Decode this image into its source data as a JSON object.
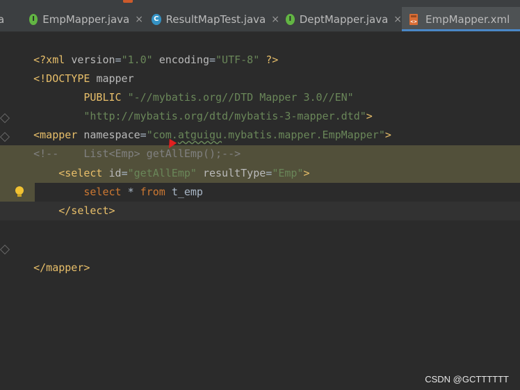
{
  "tabs": [
    {
      "label": "EmpMapper.java",
      "icon": "interface-icon",
      "active": false
    },
    {
      "label": "ResultMapTest.java",
      "icon": "class-icon",
      "active": false
    },
    {
      "label": "DeptMapper.java",
      "icon": "interface-icon",
      "active": false
    },
    {
      "label": "EmpMapper.xml",
      "icon": "xml-file-icon",
      "active": true
    }
  ],
  "tab_close": "×",
  "tab_prefix": "a",
  "colors": {
    "tag": "#e8bf6a",
    "string": "#6a8759",
    "keyword": "#cc7832",
    "comment": "#808080",
    "highlight": "#52503a",
    "active_tab_underline": "#4a88c7"
  },
  "code": {
    "l1": {
      "a": "<?xml ",
      "b": "version",
      "c": "=",
      "d": "\"1.0\"",
      "e": " encoding",
      "f": "=",
      "g": "\"UTF-8\"",
      "h": " ?>"
    },
    "l2": {
      "a": "<!DOCTYPE ",
      "b": "mapper"
    },
    "l3": {
      "a": "        PUBLIC ",
      "b": "\"-//mybatis.org//DTD Mapper 3.0//EN\""
    },
    "l4": {
      "a": "        ",
      "b": "\"http://mybatis.org/dtd/mybatis-3-mapper.dtd\"",
      "c": ">"
    },
    "l5": {
      "a": "<mapper ",
      "b": "namespace",
      "c": "=",
      "d": "\"com.",
      "e": "atguigu",
      "f": ".mybatis.mapper.EmpMapper\"",
      "g": ">"
    },
    "l6": {
      "a": "<!--    List<Emp> getAllEmp();-->"
    },
    "l7": {
      "a": "    <select ",
      "b": "id",
      "c": "=",
      "d": "\"getAllEmp\"",
      "e": " resultType",
      "f": "=",
      "g": "\"Emp\"",
      "h": ">"
    },
    "l8": {
      "a": "        select ",
      "b": "* ",
      "c": "from ",
      "d": "t_emp"
    },
    "l9": {
      "a": "    </select>"
    },
    "l10": {
      "a": "</mapper>"
    }
  },
  "watermark": "CSDN @GCTTTTTT"
}
